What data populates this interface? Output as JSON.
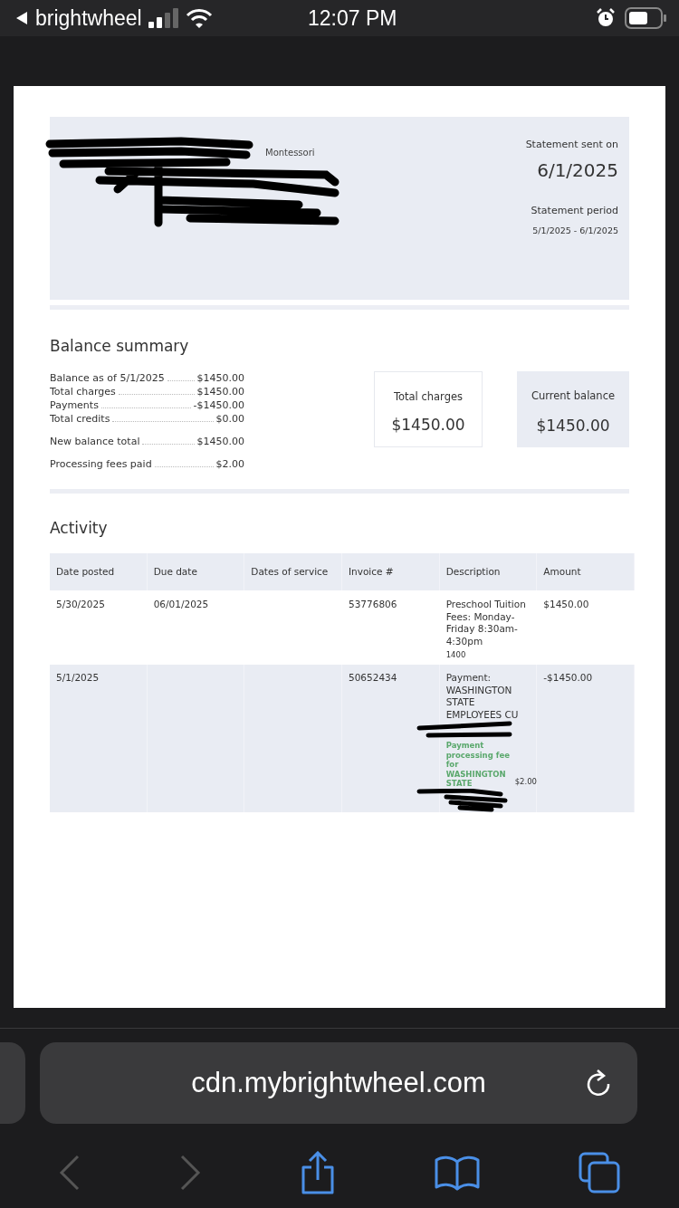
{
  "status_bar": {
    "back_label": "brightwheel",
    "time": "12:07 PM"
  },
  "statement": {
    "school": "Montessori",
    "sent_label": "Statement sent on",
    "sent_date": "6/1/2025",
    "period_label": "Statement period",
    "period": "5/1/2025 - 6/1/2025"
  },
  "balance_summary": {
    "title": "Balance summary",
    "groups": [
      [
        {
          "label": "Balance as of 5/1/2025",
          "value": "$1450.00"
        },
        {
          "label": "Total charges",
          "value": "$1450.00"
        },
        {
          "label": "Payments",
          "value": "-$1450.00"
        },
        {
          "label": "Total credits",
          "value": "$0.00"
        }
      ],
      [
        {
          "label": "New balance total",
          "value": "$1450.00"
        }
      ],
      [
        {
          "label": "Processing fees paid",
          "value": "$2.00"
        }
      ]
    ],
    "cards": [
      {
        "label": "Total charges",
        "value": "$1450.00",
        "highlighted": false
      },
      {
        "label": "Current balance",
        "value": "$1450.00",
        "highlighted": true
      }
    ]
  },
  "activity": {
    "title": "Activity",
    "columns": [
      "Date posted",
      "Due date",
      "Dates of service",
      "Invoice #",
      "Description",
      "Amount"
    ],
    "rows": [
      {
        "date_posted": "5/30/2025",
        "due_date": "06/01/2025",
        "invoice": "53776806",
        "description": "Preschool Tuition Fees: Monday-Friday 8:30am-4:30pm",
        "note": "1400",
        "amount": "$1450.00"
      },
      {
        "date_posted": "5/1/2025",
        "invoice": "50652434",
        "description": "Payment: WASHINGTON STATE EMPLOYEES CU",
        "fee": {
          "text": "Payment processing fee for WASHINGTON STATE",
          "amount": "$2.00"
        },
        "amount": "-$1450.00"
      }
    ]
  },
  "browser": {
    "url": "cdn.mybrightwheel.com",
    "back_disabled": true,
    "forward_disabled": true
  }
}
